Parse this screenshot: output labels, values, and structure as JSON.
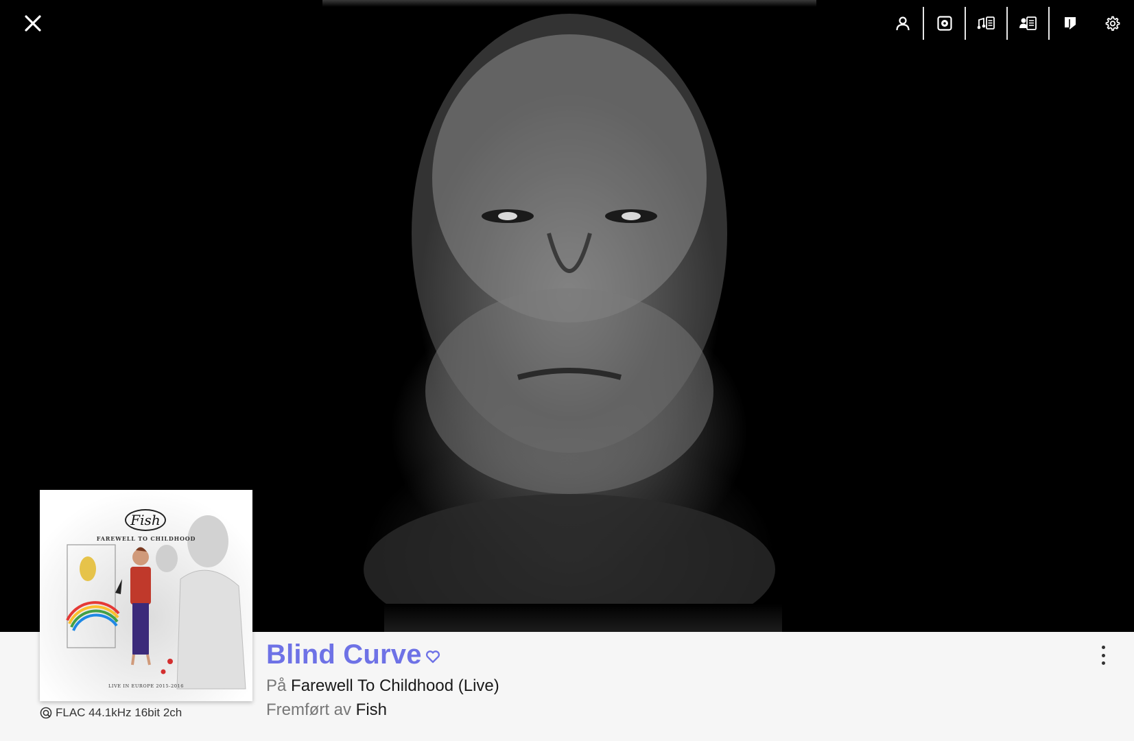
{
  "toolbar": {
    "items": [
      {
        "name": "artist-icon"
      },
      {
        "name": "album-icon"
      },
      {
        "name": "lyrics-icon"
      },
      {
        "name": "artist-bio-icon"
      },
      {
        "name": "booklet-icon"
      },
      {
        "name": "gear-icon"
      }
    ]
  },
  "cover": {
    "logo_text": "Fish",
    "title_text": "FAREWELL TO CHILDHOOD",
    "subtitle_text": "LIVE IN EUROPE 2015-2016"
  },
  "format": {
    "label": "FLAC 44.1kHz 16bit 2ch"
  },
  "track": {
    "title": "Blind Curve",
    "album_prefix": "På",
    "album": "Farewell To Childhood (Live)",
    "artist_prefix": "Fremført av",
    "artist": "Fish"
  },
  "colors": {
    "accent": "#6e72e6",
    "panel_bg": "#f6f6f6",
    "hero_bg": "#000000"
  }
}
